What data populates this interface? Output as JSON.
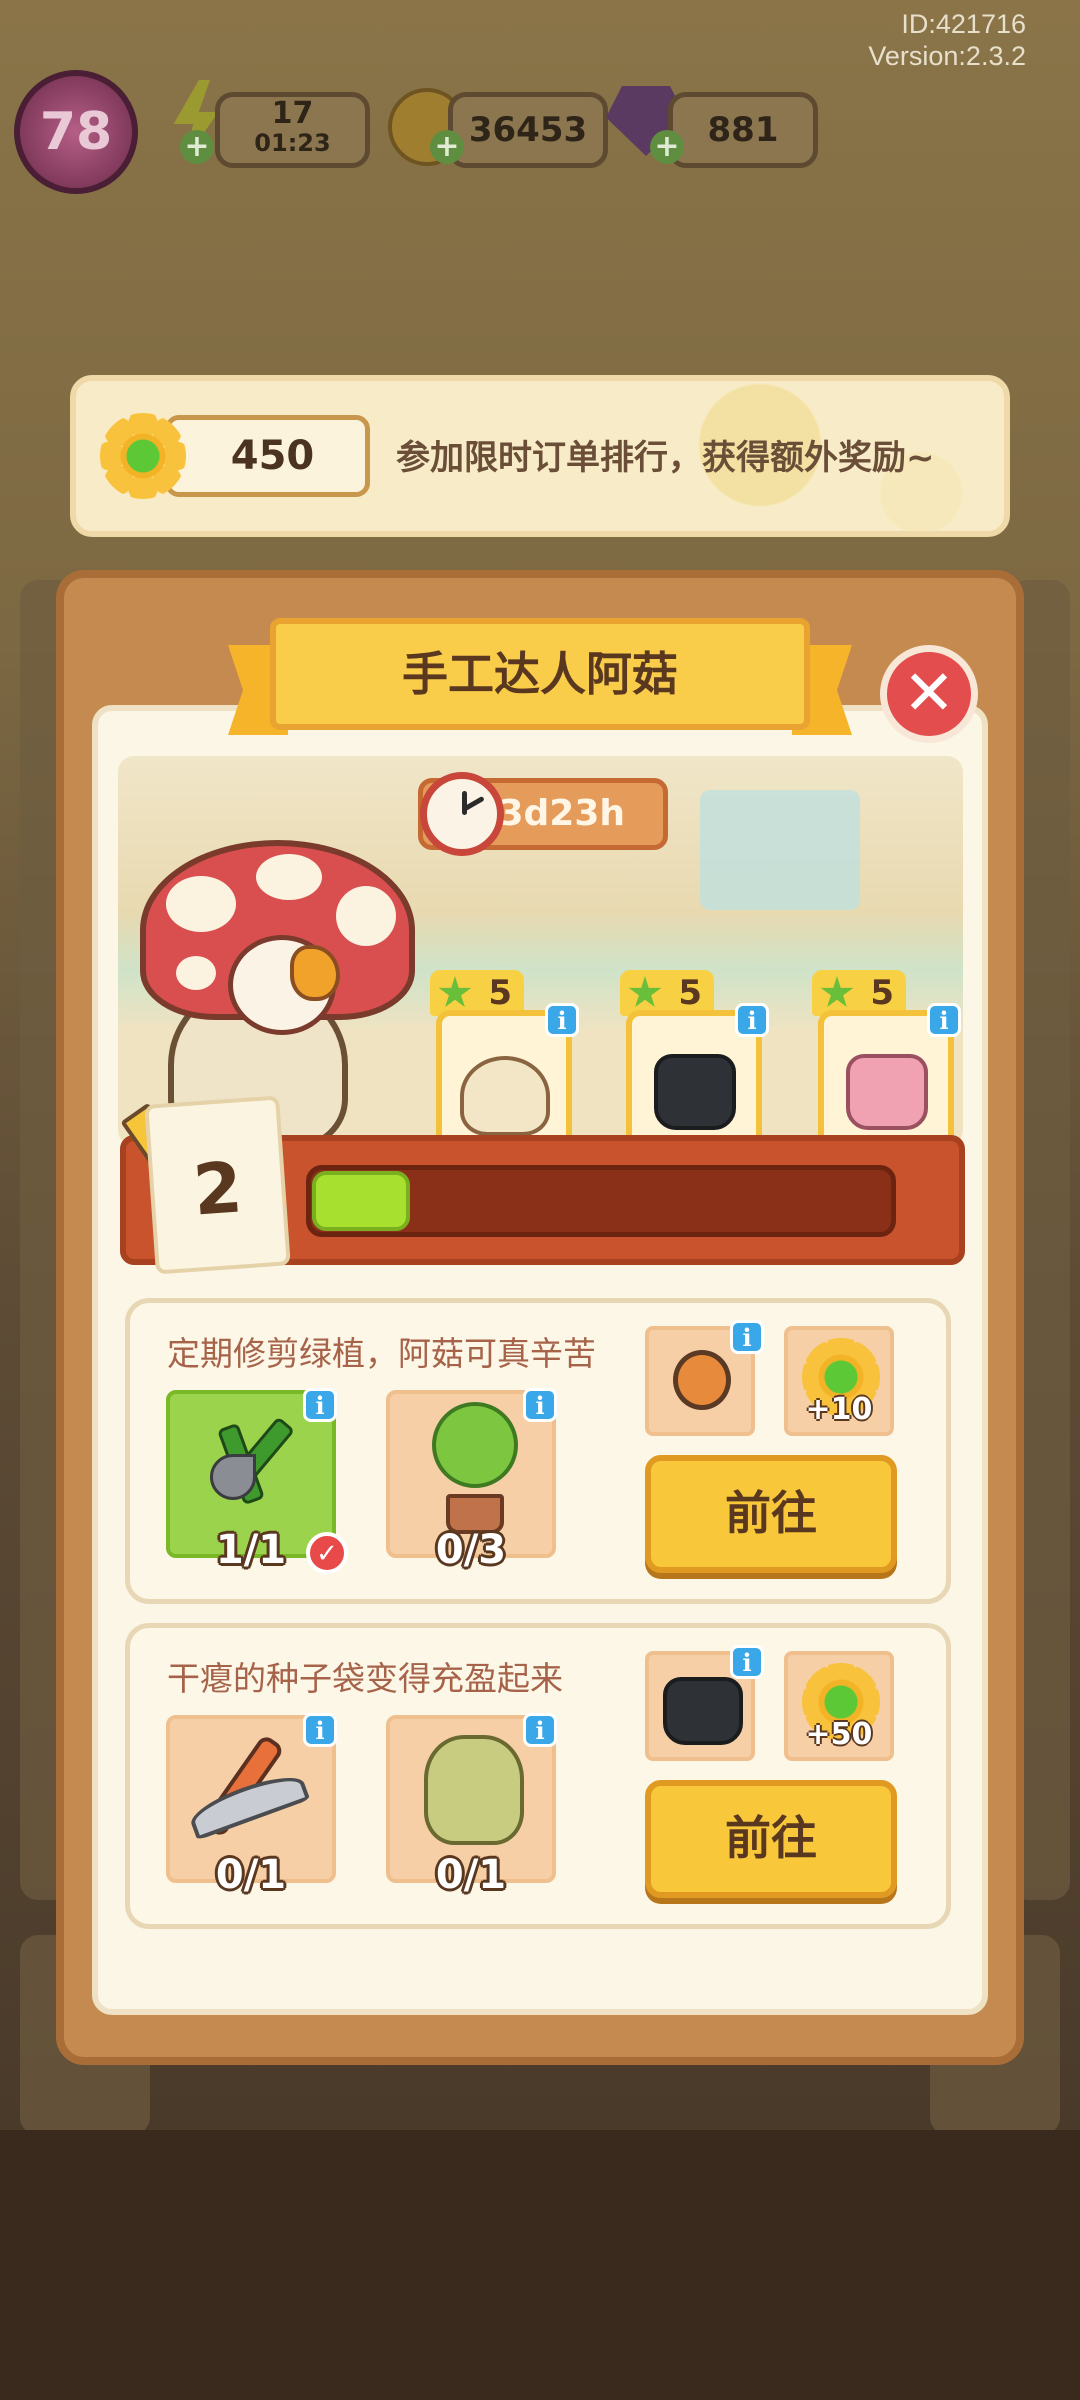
{
  "meta": {
    "id": "ID:421716",
    "version": "Version:2.3.2"
  },
  "status_bar": {
    "level": "78",
    "energy": "17",
    "energy_timer": "01:23",
    "coins": "36453",
    "gems": "881",
    "plus_symbol": "+"
  },
  "banner": {
    "points": "450",
    "message": "参加限时订单排行，获得额外奖励~"
  },
  "modal": {
    "title": "手工达人阿菇",
    "close_symbol": "✕",
    "timer": "3d23h",
    "goods": [
      {
        "stars": "5",
        "item_icon": "bread-icon"
      },
      {
        "stars": "5",
        "item_icon": "black-bag-icon"
      },
      {
        "stars": "5",
        "item_icon": "pink-bag-icon"
      }
    ],
    "info_symbol": "i",
    "progress": {
      "level": "2",
      "fraction": 0.17
    },
    "tasks": [
      {
        "title": "定期修剪绿植，阿菇可真辛苦",
        "items": [
          {
            "icon": "pruning-shears-icon",
            "count": "1/1",
            "done": true
          },
          {
            "icon": "potted-tree-icon",
            "count": "0/3",
            "done": false
          }
        ],
        "reward_item_icon": "pocket-watch-icon",
        "reward_amount": "+10",
        "button": "前往"
      },
      {
        "title": "干瘪的种子袋变得充盈起来",
        "items": [
          {
            "icon": "pickaxe-icon",
            "count": "0/1",
            "done": false
          },
          {
            "icon": "bear-plush-icon",
            "count": "0/1",
            "done": false
          }
        ],
        "reward_item_icon": "black-bag-icon",
        "reward_amount": "+50",
        "button": "前往"
      }
    ],
    "check_symbol": "✓"
  },
  "colors": {
    "accent_yellow": "#f8c83a",
    "close_red": "#e34d4d",
    "progress_green": "#a8e030",
    "panel_brown": "#c58a50"
  }
}
